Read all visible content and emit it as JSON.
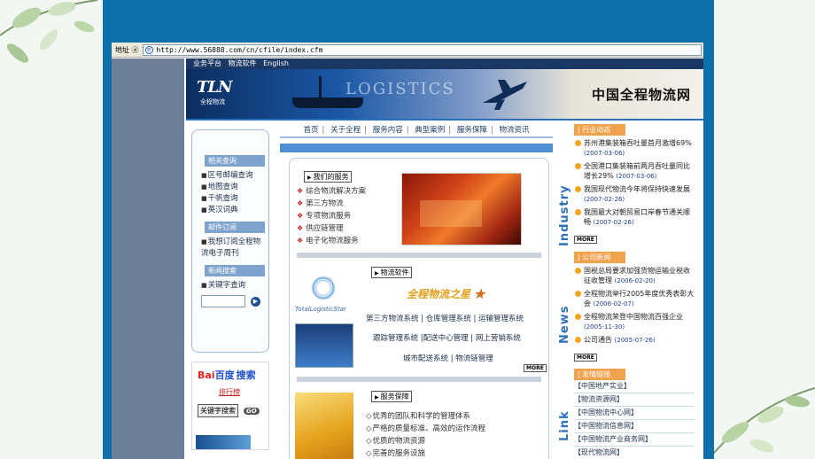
{
  "browser": {
    "address_label": "地址 ⓓ",
    "url": "http://www.56888.com/cn/cfile/index.cfm"
  },
  "topnav": [
    "业务平台",
    "物流软件",
    "English"
  ],
  "banner": {
    "logo": "TLN",
    "logo_sub": "全程物流",
    "watermark": "LOGISTICS",
    "slogan": "中国全程物流网"
  },
  "left": {
    "sections": [
      {
        "title": "相关查询",
        "items": [
          "区号邮编查询",
          "地图查询",
          "千帆查询",
          "英汉词典"
        ]
      },
      {
        "title": "邮件订阅",
        "items": [
          "我想订阅全程物流电子周刊"
        ]
      },
      {
        "title": "新闻搜索",
        "items": [
          "关键字查询"
        ]
      }
    ],
    "baidu": {
      "logo_a": "Bai",
      "logo_b": "百度",
      "logo_c": "搜索",
      "rank": "排行榜",
      "button": "关键字搜索",
      "go": "GO"
    }
  },
  "mainnav": [
    "首页",
    "关于全程",
    "服务内容",
    "典型案例",
    "服务保障",
    "物流资讯"
  ],
  "services": {
    "title": "我们的服务",
    "items": [
      "综合物流解决方案",
      "第三方物流",
      "专项物流服务",
      "供应链管理",
      "电子化物流服务"
    ]
  },
  "software": {
    "title": "物流软件",
    "logo_name": "TotalLogisticStar",
    "brand": "全程物流之星",
    "rows": [
      "第三方物流系统 | 仓库管理系统 | 运输管理系统",
      "跟踪管理系统 |配送中心管理 | 网上营销系统",
      "城市配送系统  |   物流链管理"
    ],
    "more": "MORE"
  },
  "guarantee": {
    "title": "服务保障",
    "items": [
      "优秀的团队和科学的管理体系",
      "严格的质量标准、高效的运作流程",
      "优质的物流资源",
      "完善的服务设施"
    ]
  },
  "right": {
    "labels": [
      "Industry",
      "News",
      "Link"
    ],
    "industry": {
      "title": "行业动态",
      "news": [
        {
          "text": "苏州港集装箱吞吐量首月激增69%",
          "date": "(2007-03-06)"
        },
        {
          "text": "全国港口集装箱前两月吞吐量同比增长29%",
          "date": "(2007-03-06)"
        },
        {
          "text": "我国现代物流今年将保持快速发展",
          "date": "(2007-02-26)"
        },
        {
          "text": "我国最大对朝贸易口岸春节通关顺畅",
          "date": "(2007-02-26)"
        }
      ],
      "more": "MORE"
    },
    "company": {
      "title": "公司新闻",
      "news": [
        {
          "text": "国税总局要求加强货物运输业税收征收管理",
          "date": "(2006-02-20)"
        },
        {
          "text": "全程物流举行2005年度优秀表彰大会",
          "date": "(2006-02-07)"
        },
        {
          "text": "全程物流荣登中国物流百强企业",
          "date": "(2005-11-30)"
        },
        {
          "text": "公司通告",
          "date": "(2005-07-26)"
        }
      ],
      "more": "MORE"
    },
    "links": {
      "title": "友情链接",
      "items": [
        "【中国地产实业】",
        "【物流资源网】",
        "【中国物流中心网】",
        "【中国物流信息网】",
        "【中国物流产业商务网】",
        "【现代物流网】"
      ]
    }
  }
}
